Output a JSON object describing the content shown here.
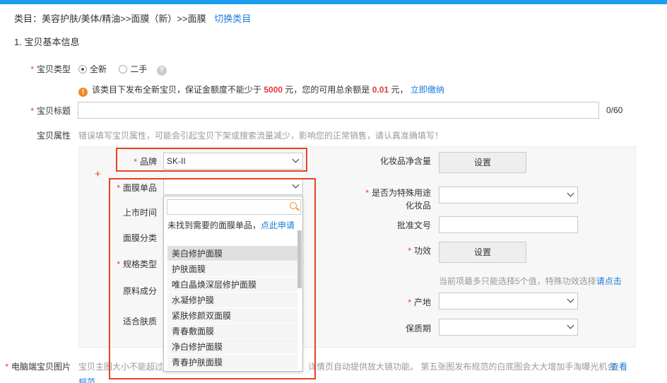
{
  "breadcrumb": {
    "text": "类目：美容护肤/美体/精油>>面膜（新）>>面膜",
    "switch_link": "切换类目"
  },
  "section": {
    "title": "1. 宝贝基本信息"
  },
  "item_type": {
    "label": "宝贝类型",
    "option_new": "全新",
    "option_used": "二手",
    "help": "?"
  },
  "notice": {
    "pre": "该类目下发布全新宝贝，保证金额度不能少于",
    "amount": "5000",
    "mid": "元，您的可用总余额是",
    "balance": "0.01",
    "post": "元，",
    "pay_link": "立即缴纳",
    "icon": "!"
  },
  "item_title": {
    "label": "宝贝标题",
    "value": "",
    "counter": "0/60"
  },
  "attributes": {
    "label": "宝贝属性",
    "hint": "错误填写宝贝属性，可能会引起宝贝下架或搜索流量减少，影响您的正常销售，请认真准确填写！"
  },
  "left_attrs": {
    "brand": {
      "label": "品牌",
      "value": "SK-II"
    },
    "product": {
      "label": "面膜单品",
      "value": ""
    },
    "launch": {
      "label": "上市时间"
    },
    "category": {
      "label": "面膜分类"
    },
    "spec": {
      "label": "规格类型"
    },
    "ingredients": {
      "label": "原料成分"
    },
    "skin": {
      "label": "适合肤质"
    }
  },
  "right_attrs": {
    "net_content": {
      "label": "化妆品净含量",
      "button": "设置"
    },
    "special_use": {
      "label_line1": "是否为特殊用途",
      "label_line2": "化妆品",
      "value": ""
    },
    "approval": {
      "label": "批准文号",
      "value": ""
    },
    "efficacy": {
      "label": "功效",
      "button": "设置"
    },
    "efficacy_hint": "当前项最多只能选择5个值，特殊功效选择",
    "efficacy_link": "请点击",
    "origin": {
      "label": "产地",
      "value": ""
    },
    "shelf_life": {
      "label": "保质期",
      "value": ""
    }
  },
  "plus_mark": "+",
  "dropdown": {
    "search_placeholder": "",
    "not_found": "未找到需要的面膜单品，",
    "apply_link": "点此申请",
    "items": [
      "美白修护面膜",
      "护肤面膜",
      "唯白晶焕深层修护面膜",
      "水凝修护膜",
      "紧肤修颜双面膜",
      "青春敷面膜",
      "净白修护面膜",
      "青春护肤面膜"
    ]
  },
  "pc_images": {
    "label": "电脑端宝贝图片",
    "hint_start": "宝贝主图大小不能超过",
    "hint_end": "详情页自动提供放大镜功能。 第五张图发布规范的白底图会大大增加手淘曝光机会",
    "view_link": "查看",
    "view_link_2": "规范"
  },
  "colors": {
    "accent": "#1a9cf0",
    "link": "#1a7bd9",
    "required": "#e4393c",
    "highlight_box": "#e8431f",
    "warning": "#f08a24"
  }
}
